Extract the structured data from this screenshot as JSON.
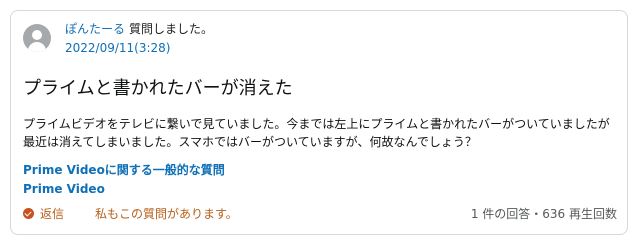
{
  "author": {
    "name": "ぽんたーる",
    "action": "質問しました。",
    "date": "2022/09/11(3:28)"
  },
  "question": {
    "title": "プライムと書かれたバーが消えた",
    "body": "プライムビデオをテレビに繋いで見ていました。今までは左上にプライムと書かれたバーがついていましたが最近は消えてしまいました。スマホではバーがついていますが、何故なんでしょう？"
  },
  "topics": [
    "Prime Videoに関する一般的な質問",
    "Prime Video"
  ],
  "footer": {
    "reply_label": "返信",
    "same_question_label": "私もこの質問があります。",
    "stats": "1 件の回答・636 再生回数"
  },
  "colors": {
    "link": "#0f6fb7",
    "action": "#b7601a",
    "muted": "#565959"
  },
  "icons": {
    "avatar": "user-avatar-icon",
    "reply": "reply-icon"
  }
}
